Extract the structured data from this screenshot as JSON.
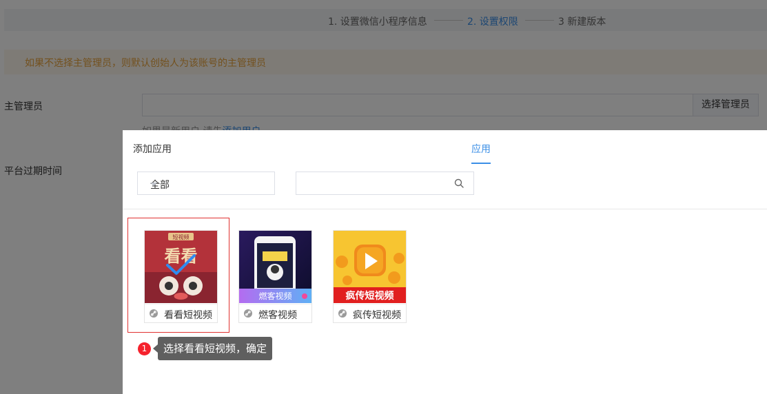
{
  "steps": {
    "step1": "1. 设置微信小程序信息",
    "step2": "2. 设置权限",
    "step3": "3 新建版本"
  },
  "notice": "如果不选择主管理员，则默认创始人为该账号的主管理员",
  "form": {
    "admin_label": "主管理员",
    "admin_button": "选择管理员",
    "hint_text": "如果是新用户,请先",
    "hint_link": "添加用户",
    "expire_label": "平台过期时间"
  },
  "modal": {
    "title": "添加应用",
    "tab": "应用",
    "select_value": "全部",
    "search_placeholder": ""
  },
  "apps": [
    {
      "name": "看看短视频",
      "poster_banner": "短视频",
      "poster_text": "看看",
      "selected": true
    },
    {
      "name": "燃客视频",
      "poster_text": "燃客视频",
      "selected": false
    },
    {
      "name": "疯传短视频",
      "poster_text": "疯传短视频",
      "selected": false
    }
  ],
  "tip": {
    "step_number": "1",
    "text": "选择看看短视频，确定"
  },
  "colors": {
    "accent": "#3a8ee6",
    "warning": "#e6a23c",
    "selected_border": "#e0302f",
    "badge": "#f5222d"
  },
  "icons": [
    "search-icon",
    "link-icon",
    "caret-down-icon",
    "checkmark-icon"
  ]
}
